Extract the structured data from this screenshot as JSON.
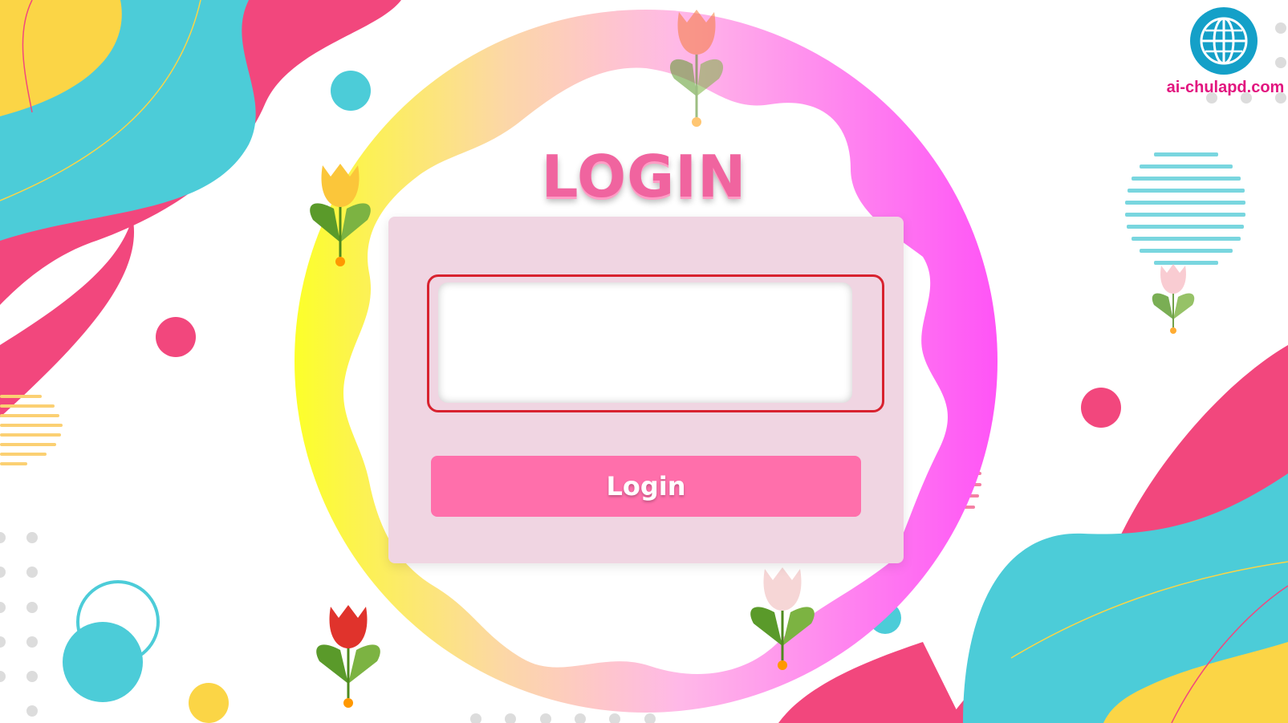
{
  "page": {
    "title": "LOGIN",
    "password_input": {
      "value": "",
      "placeholder": ""
    },
    "login_button_label": "Login"
  },
  "branding": {
    "site": "ai-chulapd.com",
    "logo_icon": "globe-icon"
  },
  "decorations": {
    "flower_icon": "tulip-icon"
  },
  "colors": {
    "accent": "#ff6fab",
    "card": "#f0d5e2",
    "title": "#f0649f",
    "highlight": "#d8222f",
    "teal": "#4cccd8",
    "yellow": "#fbd546",
    "pink": "#f2477d"
  }
}
